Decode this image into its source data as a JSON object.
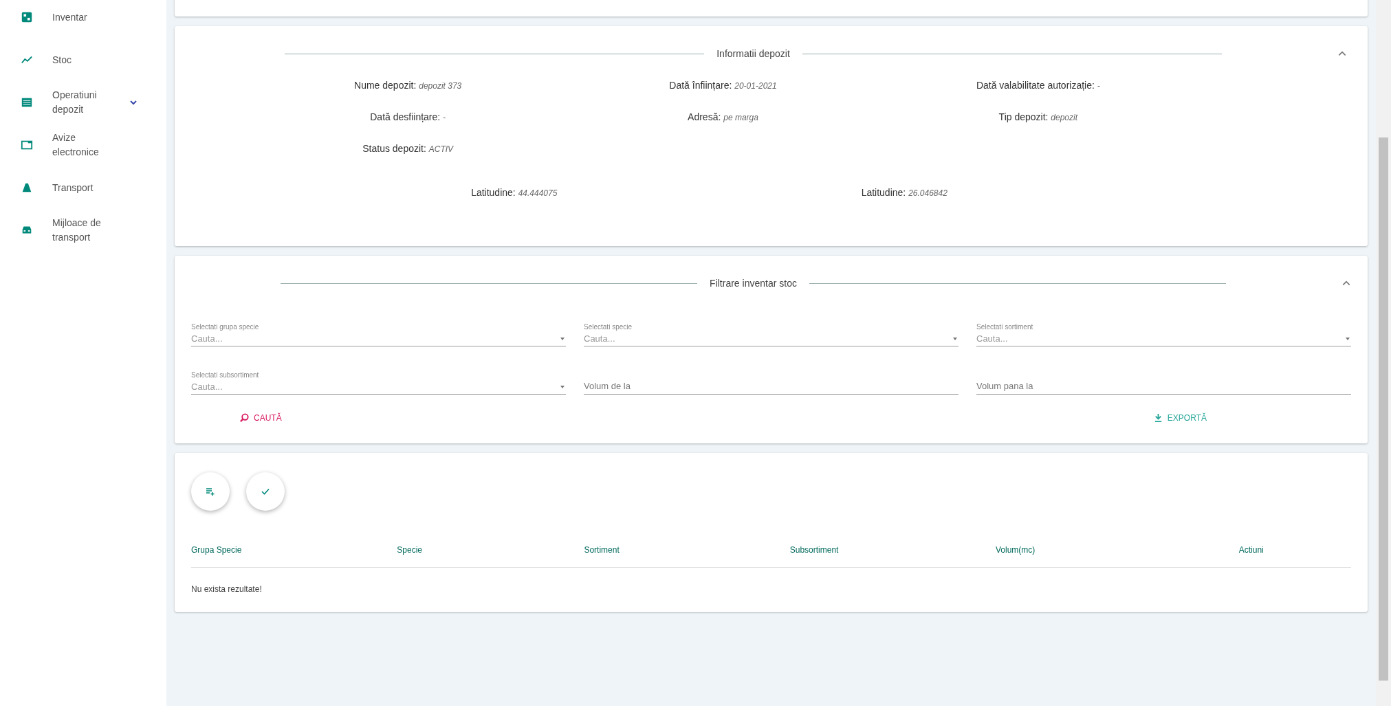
{
  "sidebar": {
    "items": [
      {
        "label": "Inventar",
        "expandable": false
      },
      {
        "label": "Stoc",
        "expandable": false
      },
      {
        "label": "Operatiuni depozit",
        "expandable": true
      },
      {
        "label": "Avize electronice",
        "expandable": false
      },
      {
        "label": "Transport",
        "expandable": false
      },
      {
        "label": "Mijloace de transport",
        "expandable": false
      }
    ]
  },
  "info_panel": {
    "title": "Informatii depozit",
    "expanded": true,
    "rows": [
      [
        {
          "label": "Nume depozit:",
          "value": "depozit 373"
        },
        {
          "label": "Dată înființare:",
          "value": "20-01-2021"
        },
        {
          "label": "Dată valabilitate autorizație:",
          "value": "-"
        }
      ],
      [
        {
          "label": "Dată desființare:",
          "value": "-"
        },
        {
          "label": "Adresă:",
          "value": "pe marga"
        },
        {
          "label": "Tip depozit:",
          "value": "depozit"
        }
      ],
      [
        {
          "label": "Status depozit:",
          "value": "ACTIV"
        }
      ]
    ],
    "coords": [
      {
        "label": "Latitudine:",
        "value": "44.444075"
      },
      {
        "label": "Latitudine:",
        "value": "26.046842"
      }
    ]
  },
  "filter_panel": {
    "title": "Filtrare inventar stoc",
    "expanded": true,
    "fields": [
      {
        "kind": "select",
        "label": "Selectati grupa specie",
        "placeholder": "Cauta..."
      },
      {
        "kind": "select",
        "label": "Selectati specie",
        "placeholder": "Cauta..."
      },
      {
        "kind": "select",
        "label": "Selectati sortiment",
        "placeholder": "Cauta..."
      },
      {
        "kind": "select",
        "label": "Selectati subsortiment",
        "placeholder": "Cauta..."
      },
      {
        "kind": "text",
        "placeholder": "Volum de la"
      },
      {
        "kind": "text",
        "placeholder": "Volum pana la"
      }
    ],
    "search_button": "CAUTĂ",
    "export_button": "EXPORTĂ"
  },
  "table": {
    "columns": [
      "Grupa Specie",
      "Specie",
      "Sortiment",
      "Subsortiment",
      "Volum(mc)",
      "Actiuni"
    ],
    "empty_message": "Nu exista rezultate!"
  }
}
